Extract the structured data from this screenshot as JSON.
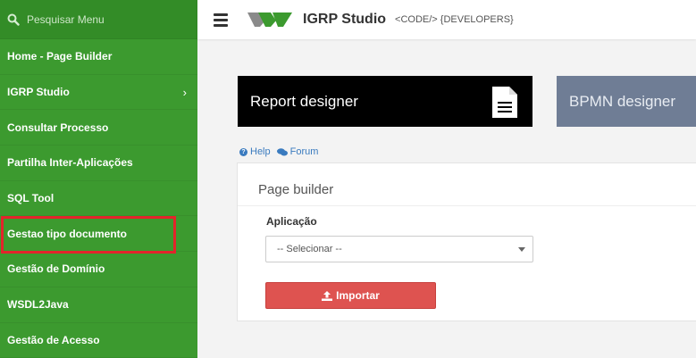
{
  "sidebar": {
    "search": {
      "placeholder": "Pesquisar Menu"
    },
    "items": [
      {
        "label": "Home - Page Builder"
      },
      {
        "label": "IGRP Studio",
        "has_submenu": true
      },
      {
        "label": "Consultar Processo"
      },
      {
        "label": "Partilha Inter-Aplicações"
      },
      {
        "label": "SQL Tool"
      },
      {
        "label": "Gestao tipo documento",
        "highlighted": true
      },
      {
        "label": "Gestão de Domínio"
      },
      {
        "label": "WSDL2Java"
      },
      {
        "label": "Gestão de Acesso"
      }
    ],
    "chevron_glyph": "›",
    "bg_color": "#3c9a2f",
    "highlight_color": "#e3242b"
  },
  "header": {
    "title": "IGRP Studio",
    "subtitle": "<CODE/> {DEVELOPERS}"
  },
  "tiles": [
    {
      "label": "Report designer",
      "icon": "document-icon",
      "bg": "#000000"
    },
    {
      "label": "BPMN designer",
      "bg": "#6f7d95"
    }
  ],
  "links": {
    "help": "Help",
    "forum": "Forum"
  },
  "panel": {
    "title": "Page builder",
    "field_label": "Aplicação",
    "select_value": "-- Selecionar --",
    "import_label": "Importar",
    "import_color": "#de5350"
  }
}
